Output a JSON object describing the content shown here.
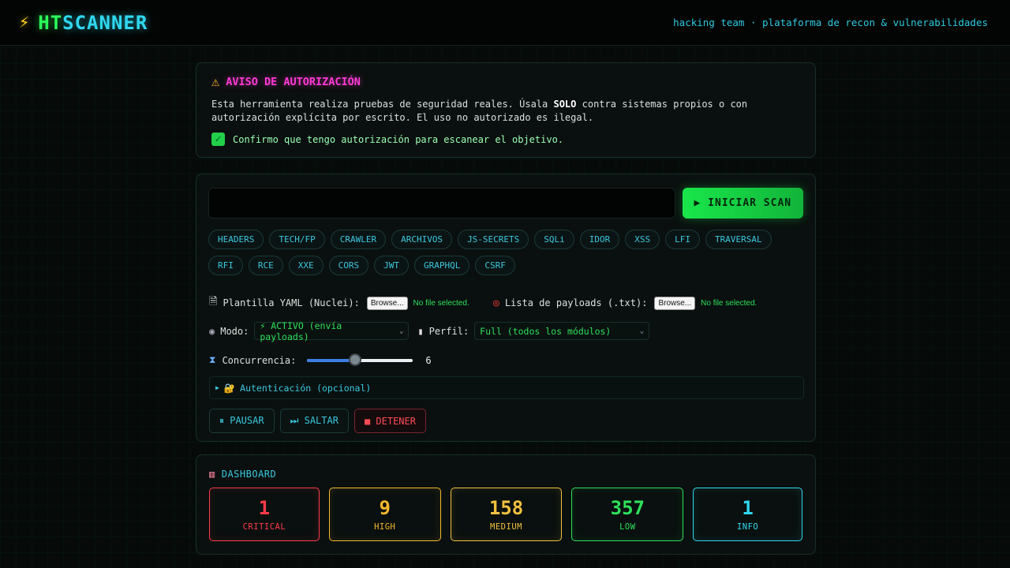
{
  "header": {
    "bolt": "⚡",
    "brand_ht": "HT",
    "brand_scan": "SCANNER",
    "tagline": "hacking team · plataforma de recon & vulnerabilidades"
  },
  "auth": {
    "icon": "warning-icon",
    "title": "AVISO DE AUTORIZACIÓN",
    "text_before": "Esta herramienta realiza pruebas de seguridad reales. Úsala ",
    "text_bold": "SOLO",
    "text_after": " contra sistemas propios o con autorización explícita por escrito. El uso no autorizado es ilegal.",
    "confirm_label": "Confirmo que tengo autorización para escanear el objetivo.",
    "confirmed": true
  },
  "scan": {
    "target_value": "",
    "start_label": "▶ INICIAR SCAN",
    "modules": [
      "HEADERS",
      "TECH/FP",
      "CRAWLER",
      "ARCHIVOS",
      "JS-SECRETS",
      "SQLi",
      "IDOR",
      "XSS",
      "LFI",
      "TRAVERSAL",
      "RFI",
      "RCE",
      "XXE",
      "CORS",
      "JWT",
      "GRAPHQL",
      "CSRF"
    ],
    "yaml_label": "Plantilla YAML (Nuclei):",
    "payloads_label": "Lista de payloads (.txt):",
    "browse_label": "Browse...",
    "no_file": "No file selected.",
    "mode_label": "Modo:",
    "mode_value": "⚡ ACTIVO (envía payloads)",
    "profile_label": "Perfil:",
    "profile_value": "Full (todos los módulos)",
    "concurrency_label": "Concurrencia:",
    "concurrency_value": 6,
    "concurrency_min": 1,
    "concurrency_max": 12,
    "auth_toggle": "Autenticación (opcional)",
    "pause_label": "⏸ PAUSAR",
    "skip_label": "⏭ SALTAR",
    "stop_label": "■ DETENER"
  },
  "dashboard": {
    "title": "DASHBOARD",
    "cards": [
      {
        "count": "1",
        "label": "CRITICAL",
        "color": "#ff3b4a"
      },
      {
        "count": "9",
        "label": "HIGH",
        "color": "#f5b82e"
      },
      {
        "count": "158",
        "label": "MEDIUM",
        "color": "#f0c040"
      },
      {
        "count": "357",
        "label": "LOW",
        "color": "#2fe05a"
      },
      {
        "count": "1",
        "label": "INFO",
        "color": "#2fd8f0"
      }
    ]
  }
}
